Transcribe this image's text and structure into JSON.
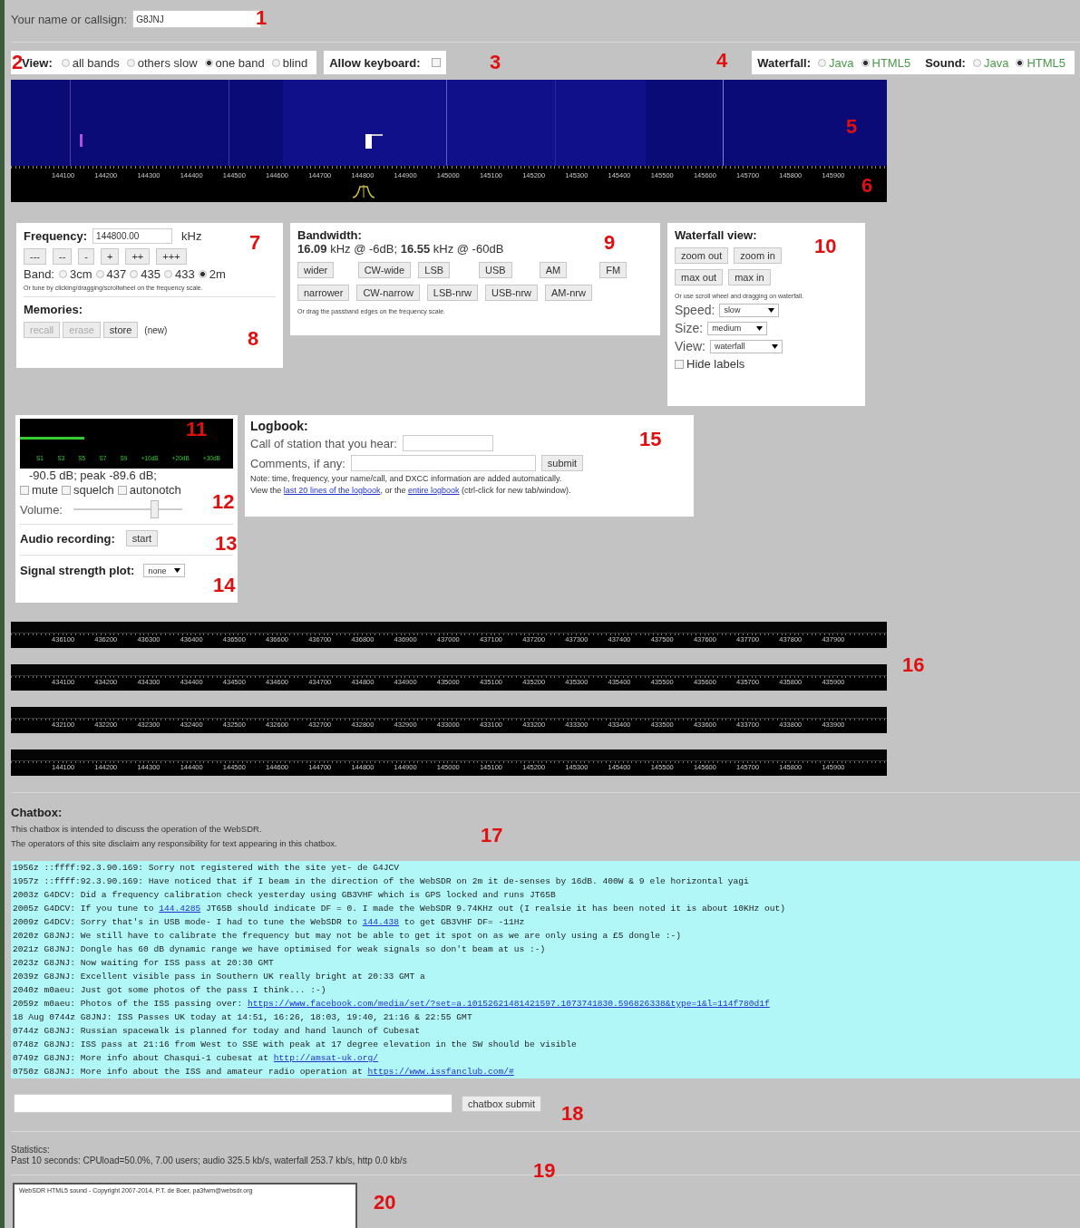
{
  "callsign": {
    "label": "Your name or callsign:",
    "value": "G8JNJ"
  },
  "view": {
    "label": "View:",
    "options": [
      {
        "label": "all bands",
        "selected": false
      },
      {
        "label": "others slow",
        "selected": false
      },
      {
        "label": "one band",
        "selected": true
      },
      {
        "label": "blind",
        "selected": false
      }
    ]
  },
  "keyboard": {
    "label": "Allow keyboard:",
    "checked": false
  },
  "waterfall_mode": {
    "label": "Waterfall:",
    "options": [
      {
        "label": "Java",
        "selected": false
      },
      {
        "label": "HTML5",
        "selected": true
      }
    ]
  },
  "sound_mode": {
    "label": "Sound:",
    "options": [
      {
        "label": "Java",
        "selected": false
      },
      {
        "label": "HTML5",
        "selected": true
      }
    ]
  },
  "waterfall": {
    "scale": [
      "144100",
      "144200",
      "144300",
      "144400",
      "144500",
      "144600",
      "144700",
      "144800",
      "144900",
      "145000",
      "145100",
      "145200",
      "145300",
      "145400",
      "145500",
      "145600",
      "145700",
      "145800",
      "145900"
    ]
  },
  "frequency": {
    "label": "Frequency:",
    "value": "144800.00",
    "unit": "kHz",
    "steps": [
      "---",
      "--",
      "-",
      "+",
      "++",
      "+++"
    ],
    "band_label": "Band:",
    "bands": [
      {
        "label": "3cm",
        "selected": false
      },
      {
        "label": "437",
        "selected": false
      },
      {
        "label": "435",
        "selected": false
      },
      {
        "label": "433",
        "selected": false
      },
      {
        "label": "2m",
        "selected": true
      }
    ],
    "hint": "Or tune by clicking/dragging/scrollwheel on the frequency scale."
  },
  "memories": {
    "title": "Memories:",
    "buttons": [
      {
        "label": "recall",
        "disabled": true
      },
      {
        "label": "erase",
        "disabled": true
      },
      {
        "label": "store",
        "disabled": false
      }
    ],
    "note": "(new)"
  },
  "bandwidth": {
    "title": "Bandwidth:",
    "reading": "**16.09** kHz @ -6dB; **16.55** kHz @ -60dB",
    "rows": [
      [
        "wider",
        "CW-wide",
        "LSB",
        "USB",
        "AM",
        "FM"
      ],
      [
        "narrower",
        "CW-narrow",
        "LSB-nrw",
        "USB-nrw",
        "AM-nrw"
      ]
    ],
    "hint": "Or drag the passband edges on the frequency scale."
  },
  "waterfall_view": {
    "title": "Waterfall view:",
    "rows": [
      [
        "zoom out",
        "zoom in"
      ],
      [
        "max out",
        "max in"
      ]
    ],
    "hint": "Or use scroll wheel and dragging on waterfall.",
    "selects": [
      {
        "label": "Speed:",
        "value": "slow"
      },
      {
        "label": "Size:",
        "value": "medium"
      },
      {
        "label": "View:",
        "value": "waterfall"
      }
    ],
    "hide_labels": {
      "label": "Hide labels",
      "checked": false
    }
  },
  "meter": {
    "level": 0.3,
    "scale": [
      "S1",
      "S3",
      "S5",
      "S7",
      "S9",
      "+10dB",
      "+20dB",
      "+30dB"
    ],
    "reading": "-90.5 dB; peak -89.6 dB;"
  },
  "audio": {
    "checkboxes": [
      {
        "label": "mute",
        "checked": false
      },
      {
        "label": "squelch",
        "checked": false
      },
      {
        "label": "autonotch",
        "checked": false
      }
    ],
    "volume_label": "Volume:",
    "volume": {
      "level": 0.75
    }
  },
  "recording": {
    "label": "Audio recording:",
    "button": "start"
  },
  "signal_plot": {
    "label": "Signal strength plot:",
    "value": "none"
  },
  "logbook": {
    "title": "Logbook:",
    "call_label": "Call of station that you hear:",
    "comments_label": "Comments, if any:",
    "button": "submit",
    "note": "Note: time, frequency, your name/call, and DXCC information are added automatically.",
    "view": [
      {
        "kind": "text",
        "text": "View the "
      },
      {
        "kind": "link",
        "text": "last 20 lines of the logbook"
      },
      {
        "kind": "text",
        "text": ", or the "
      },
      {
        "kind": "link",
        "text": "entire logbook"
      },
      {
        "kind": "text",
        "text": " (ctrl-click for new tab/window)."
      }
    ]
  },
  "bands": [
    {
      "scale": [
        "436100",
        "436200",
        "436300",
        "436400",
        "436500",
        "436600",
        "436700",
        "436800",
        "436900",
        "437000",
        "437100",
        "437200",
        "437300",
        "437400",
        "437500",
        "437600",
        "437700",
        "437800",
        "437900"
      ]
    },
    {
      "scale": [
        "434100",
        "434200",
        "434300",
        "434400",
        "434500",
        "434600",
        "434700",
        "434800",
        "434900",
        "435000",
        "435100",
        "435200",
        "435300",
        "435400",
        "435500",
        "435600",
        "435700",
        "435800",
        "435900"
      ]
    },
    {
      "scale": [
        "432100",
        "432200",
        "432300",
        "432400",
        "432500",
        "432600",
        "432700",
        "432800",
        "432900",
        "433000",
        "433100",
        "433200",
        "433300",
        "433400",
        "433500",
        "433600",
        "433700",
        "433800",
        "433900"
      ]
    },
    {
      "scale": [
        "144100",
        "144200",
        "144300",
        "144400",
        "144500",
        "144600",
        "144700",
        "144800",
        "144900",
        "145000",
        "145100",
        "145200",
        "145300",
        "145400",
        "145500",
        "145600",
        "145700",
        "145800",
        "145900"
      ]
    }
  ],
  "chatbox": {
    "title": "Chatbox:",
    "lines": [
      "This chatbox is intended to discuss the operation of the WebSDR.",
      "The operators of this site disclaim any responsibility for text appearing in this chatbox."
    ],
    "messages": [
      [
        {
          "kind": "text",
          "text": "1956z ::ffff:92.3.90.169: Sorry not registered with the site yet- de G4JCV"
        }
      ],
      [
        {
          "kind": "text",
          "text": "1957z ::ffff:92.3.90.169: Have noticed that if I beam in the direction of the WebSDR on 2m it de-senses by 16dB. 400W & 9 ele horizontal yagi"
        }
      ],
      [
        {
          "kind": "text",
          "text": "2003z G4DCV: Did a frequency calibration check yesterday using GB3VHF which is GPS locked and runs JT65B"
        }
      ],
      [
        {
          "kind": "text",
          "text": "2005z G4DCV: If you tune to "
        },
        {
          "kind": "link",
          "text": "144.4285"
        },
        {
          "kind": "text",
          "text": " JT65B should indicate DF = 0. I made the WebSDR 9.74KHz out (I realsie it has been noted it is about 10KHz out)"
        }
      ],
      [
        {
          "kind": "text",
          "text": "2009z G4DCV: Sorry that's in USB mode- I had to tune the WebSDR to "
        },
        {
          "kind": "link",
          "text": "144.438"
        },
        {
          "kind": "text",
          "text": " to get GB3VHF DF= -11Hz"
        }
      ],
      [
        {
          "kind": "text",
          "text": "2020z G8JNJ: We still have to calibrate the frequency but may not be able to get it spot on as we are only using a £5 dongle :-)"
        }
      ],
      [
        {
          "kind": "text",
          "text": "2021z G8JNJ: Dongle has 60 dB dynamic range we have optimised for weak signals so don't beam at us :-)"
        }
      ],
      [
        {
          "kind": "text",
          "text": "2023z G8JNJ: Now waiting for ISS pass at 20:30 GMT"
        }
      ],
      [
        {
          "kind": "text",
          "text": "2039z G8JNJ: Excellent visible pass in Southern UK really bright at 20:33 GMT a"
        }
      ],
      [
        {
          "kind": "text",
          "text": "2040z m0aeu: Just got some photos of the pass I think... :-)"
        }
      ],
      [
        {
          "kind": "text",
          "text": "2059z m0aeu: Photos of the ISS passing over: "
        },
        {
          "kind": "link",
          "text": "https://www.facebook.com/media/set/?set=a.10152621481421597.1073741830.596826338&type=1&l=114f780d1f"
        }
      ],
      [
        {
          "kind": "text",
          "text": "18 Aug 0744z G8JNJ: ISS Passes UK today at 14:51, 16:26, 18:03, 19:40, 21:16 & 22:55 GMT"
        }
      ],
      [
        {
          "kind": "text",
          "text": "0744z G8JNJ: Russian spacewalk is planned for today and hand launch of Cubesat"
        }
      ],
      [
        {
          "kind": "text",
          "text": "0748z G8JNJ: ISS pass at 21:16 from West to SSE with peak at 17 degree elevation in the SW should be visible"
        }
      ],
      [
        {
          "kind": "text",
          "text": "0749z G8JNJ: More info about Chasqui-1 cubesat at "
        },
        {
          "kind": "link",
          "text": "http://amsat-uk.org/"
        }
      ],
      [
        {
          "kind": "text",
          "text": "0750z G8JNJ: More info about the ISS and amateur radio operation at "
        },
        {
          "kind": "link",
          "text": "https://www.issfanclub.com/#"
        }
      ]
    ],
    "button": "chatbox submit"
  },
  "statistics": {
    "title": "Statistics:",
    "line": "Past 10 seconds: CPUload=50.0%, 7.00 users; audio 325.5 kb/s, waterfall 253.7 kb/s, http 0.0 kb/s"
  },
  "log_output": "WebSDR HTML5 sound - Copyright 2007-2014, P.T. de Boer, pa3fwm@websdr.org",
  "annotations": [
    "1",
    "2",
    "3",
    "4",
    "5",
    "6",
    "7",
    "8",
    "9",
    "10",
    "11",
    "12",
    "13",
    "14",
    "15",
    "16",
    "17",
    "18",
    "19",
    "20"
  ]
}
